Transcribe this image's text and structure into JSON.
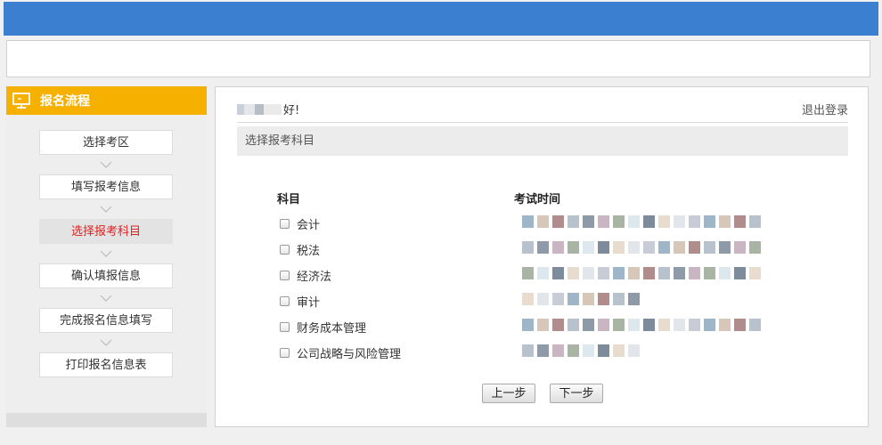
{
  "colors": {
    "topbar": "#3a7fd0",
    "sidebar_header": "#f5b000",
    "active_step_text": "#e02020"
  },
  "sidebar": {
    "title": "报名流程",
    "icon": "monitor-icon",
    "steps": [
      {
        "label": "选择考区",
        "active": false
      },
      {
        "label": "填写报考信息",
        "active": false
      },
      {
        "label": "选择报考科目",
        "active": true
      },
      {
        "label": "确认填报信息",
        "active": false
      },
      {
        "label": "完成报名信息填写",
        "active": false
      },
      {
        "label": "打印报名信息表",
        "active": false
      }
    ]
  },
  "main": {
    "greeting_suffix": "好!",
    "logout": "退出登录",
    "section_title": "选择报考科目",
    "subject_header": "科目",
    "time_header": "考试时间",
    "subjects": [
      {
        "name": "会计",
        "checked": false,
        "exam_time": "xxxxxxxxxxxxxxxx"
      },
      {
        "name": "税法",
        "checked": false,
        "exam_time": "xxxxxxxxxxxxxxxx"
      },
      {
        "name": "经济法",
        "checked": false,
        "exam_time": "xxxxxxxxxxxxxxxx"
      },
      {
        "name": "审计",
        "checked": false,
        "exam_time": "xxxxxxxx"
      },
      {
        "name": "财务成本管理",
        "checked": false,
        "exam_time": "xxxxxxxxxxxxxxxx"
      },
      {
        "name": "公司战略与风险管理",
        "checked": false,
        "exam_time": "xxxxxxxx"
      }
    ],
    "prev_button": "上一步",
    "next_button": "下一步"
  }
}
